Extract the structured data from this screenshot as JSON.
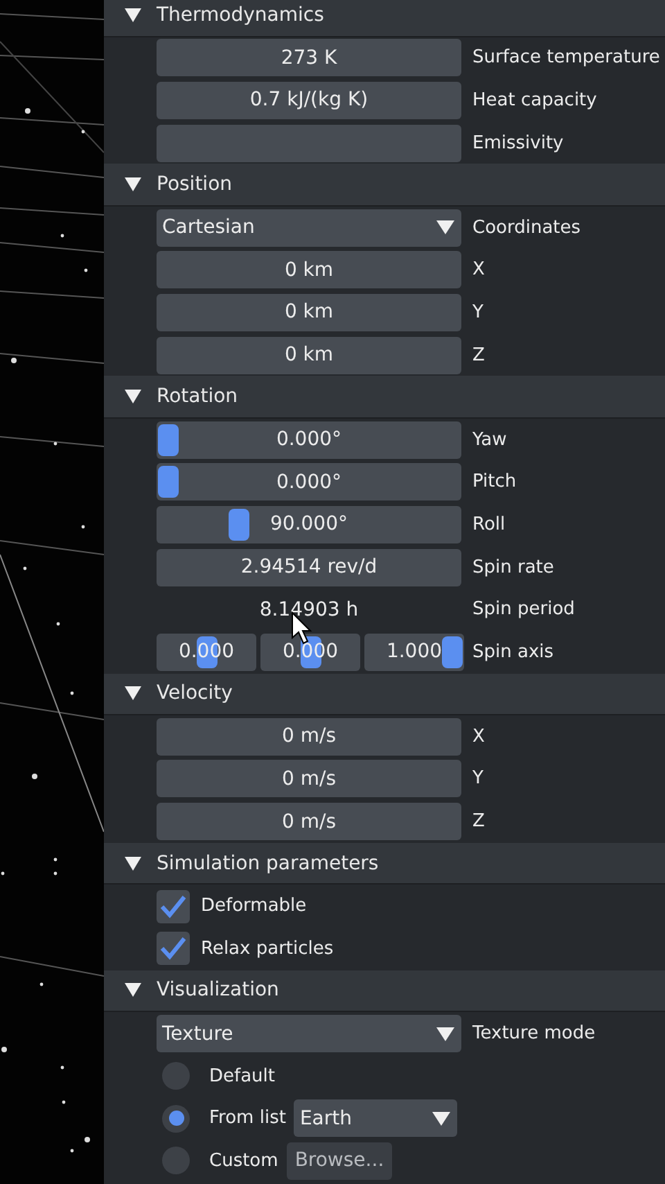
{
  "sections": [
    {
      "title": "Thermodynamics",
      "expanded": true,
      "rows": [
        {
          "kind": "field",
          "value": "273 K",
          "label": "Surface temperature"
        },
        {
          "kind": "field",
          "value": "0.7 kJ/(kg K)",
          "label": "Heat capacity"
        },
        {
          "kind": "field",
          "label": "Emissivity"
        }
      ]
    },
    {
      "title": "Position",
      "expanded": true,
      "rows": [
        {
          "kind": "dropdown",
          "value": "Cartesian",
          "label": "Coordinates"
        },
        {
          "kind": "field",
          "value": "0 km",
          "label": "X"
        },
        {
          "kind": "field",
          "value": "0 km",
          "label": "Y"
        },
        {
          "kind": "field",
          "value": "0 km",
          "label": "Z"
        }
      ]
    },
    {
      "title": "Rotation",
      "expanded": true,
      "rows": [
        {
          "kind": "slider",
          "value": "0.000°",
          "level": 0,
          "label": "Yaw"
        },
        {
          "kind": "slider",
          "value": "0.000°",
          "level": 0,
          "label": "Pitch"
        },
        {
          "kind": "slider",
          "value": "90.000°",
          "level": 0.25,
          "label": "Roll"
        },
        {
          "kind": "field",
          "value": "2.94514 rev/d",
          "label": "Spin rate"
        },
        {
          "kind": "readonly",
          "value": "8.14903 h",
          "label": "Spin period"
        },
        {
          "kind": "triple",
          "label": "Spin axis",
          "parts": [
            {
              "value": "0.000",
              "level": 0.5
            },
            {
              "value": "0.000",
              "level": 0.5
            },
            {
              "value": "1.000",
              "level": 1
            }
          ]
        }
      ]
    },
    {
      "title": "Velocity",
      "expanded": true,
      "rows": [
        {
          "kind": "field",
          "value": "0 m/s",
          "label": "X"
        },
        {
          "kind": "field",
          "value": "0 m/s",
          "label": "Y"
        },
        {
          "kind": "field",
          "value": "0 m/s",
          "label": "Z"
        }
      ]
    },
    {
      "title": "Simulation parameters",
      "expanded": true,
      "rows": [
        {
          "kind": "checkbox",
          "checked": true,
          "label": "Deformable"
        },
        {
          "kind": "checkbox",
          "checked": true,
          "label": "Relax particles"
        }
      ]
    },
    {
      "title": "Visualization",
      "expanded": true,
      "rows": [
        {
          "kind": "dropdown",
          "value": "Texture",
          "label": "Texture mode"
        }
      ],
      "options": [
        {
          "kind": "radio",
          "selected": false,
          "label": "Default"
        },
        {
          "kind": "radio",
          "selected": true,
          "label": "From list",
          "dropdown": "Earth"
        },
        {
          "kind": "radio",
          "selected": false,
          "label": "Custom",
          "button": "Browse..."
        }
      ]
    }
  ]
}
